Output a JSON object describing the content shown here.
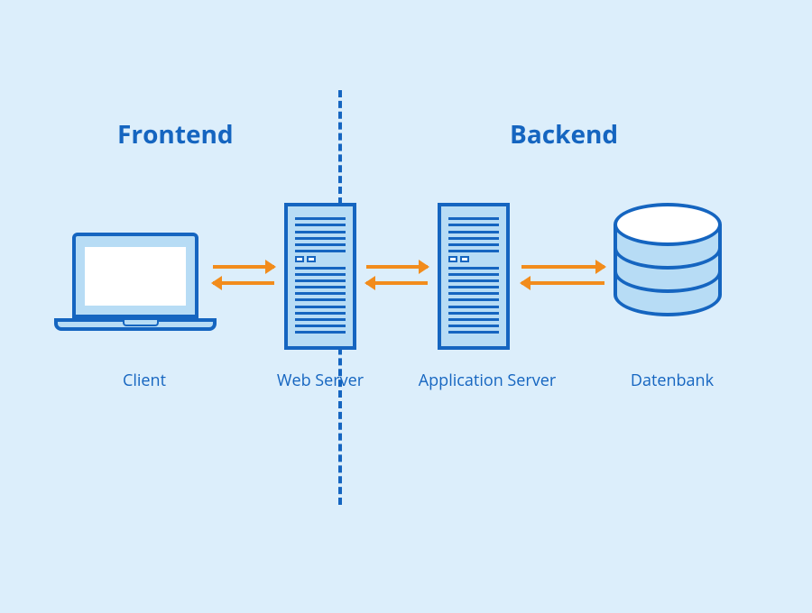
{
  "sections": {
    "frontend": "Frontend",
    "backend": "Backend"
  },
  "nodes": {
    "client": "Client",
    "web_server": "Web Server",
    "application_server": "Application Server",
    "database": "Datenbank"
  },
  "colors": {
    "background": "#dceefb",
    "stroke": "#1565c0",
    "fill": "#b7dcf5",
    "arrow": "#f28c1c"
  },
  "diagram": {
    "divider_between": [
      "web_server",
      "application_server"
    ],
    "connections": [
      {
        "from": "client",
        "to": "web_server",
        "bidirectional": true
      },
      {
        "from": "web_server",
        "to": "application_server",
        "bidirectional": true
      },
      {
        "from": "application_server",
        "to": "database",
        "bidirectional": true
      }
    ]
  }
}
